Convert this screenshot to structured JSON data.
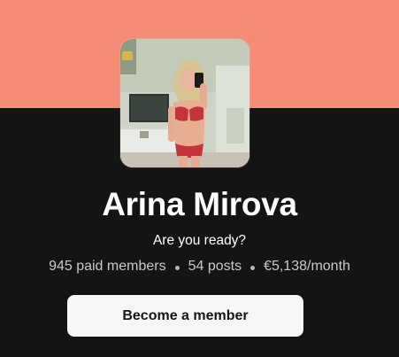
{
  "profile": {
    "name": "Arina Mirova",
    "tagline": "Are you ready?",
    "avatar_alt": "profile photo",
    "stats": {
      "members": "945 paid members",
      "posts": "54 posts",
      "earnings": "€5,138/month"
    },
    "cta_label": "Become a member"
  },
  "colors": {
    "cover": "#f68b77",
    "background": "#141414",
    "button": "#f7f7f7"
  }
}
